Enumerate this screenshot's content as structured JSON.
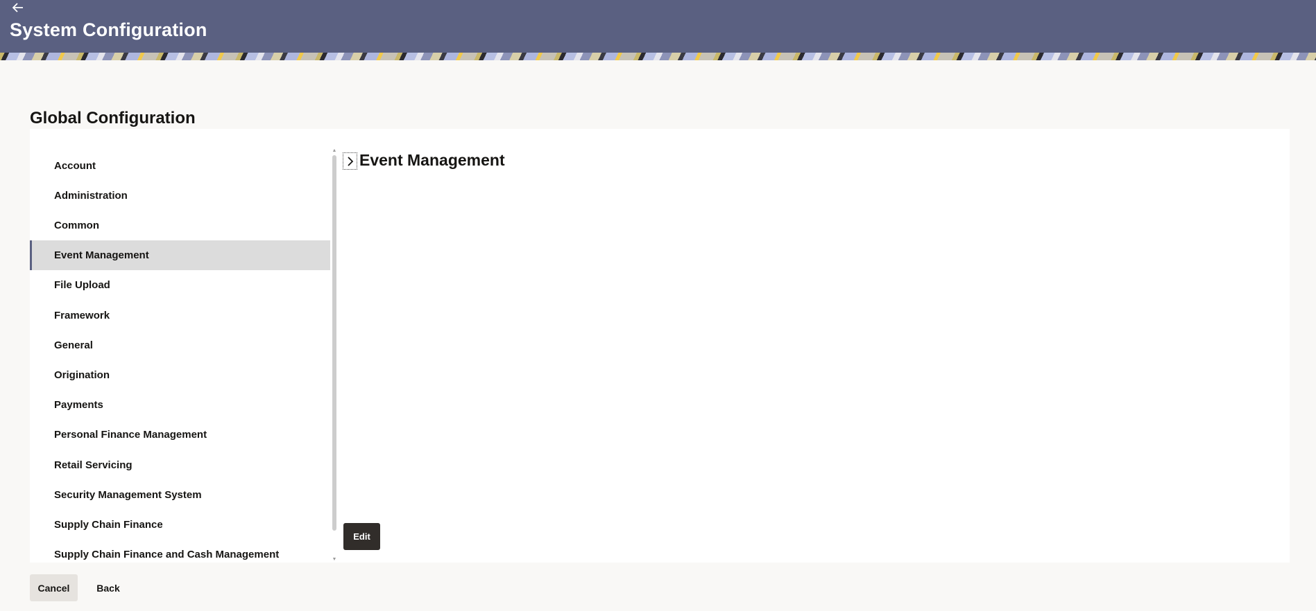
{
  "header": {
    "back_icon": "arrow-left-icon",
    "title": "System Configuration",
    "background_color": "#5a6081"
  },
  "section": {
    "title": "Global Configuration"
  },
  "sidebar": {
    "items": [
      {
        "label": "Account",
        "active": false
      },
      {
        "label": "Administration",
        "active": false
      },
      {
        "label": "Common",
        "active": false
      },
      {
        "label": "Event Management",
        "active": true
      },
      {
        "label": "File Upload",
        "active": false
      },
      {
        "label": "Framework",
        "active": false
      },
      {
        "label": "General",
        "active": false
      },
      {
        "label": "Origination",
        "active": false
      },
      {
        "label": "Payments",
        "active": false
      },
      {
        "label": "Personal Finance Management",
        "active": false
      },
      {
        "label": "Retail Servicing",
        "active": false
      },
      {
        "label": "Security Management System",
        "active": false
      },
      {
        "label": "Supply Chain Finance",
        "active": false
      },
      {
        "label": "Supply Chain Finance and Cash Management",
        "active": false
      }
    ],
    "active_color": "#dcdcdc"
  },
  "content": {
    "expand_icon": "chevron-right-icon",
    "heading": "Event Management",
    "edit_label": "Edit"
  },
  "footer": {
    "cancel_label": "Cancel",
    "back_label": "Back"
  }
}
